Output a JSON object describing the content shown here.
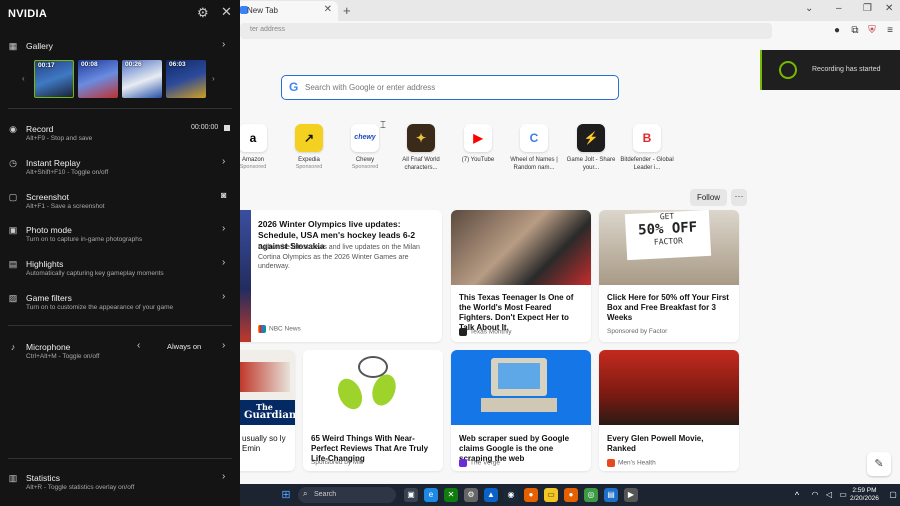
{
  "browser": {
    "tab_title": "New Tab",
    "address_placeholder": "ter address",
    "search_placeholder": "Search with Google or enter address",
    "window_controls": [
      "–",
      "❐",
      "✕"
    ]
  },
  "shortcuts": [
    {
      "label": "Amazon",
      "sub": "Sponsored",
      "glyph": "a",
      "color": "#000000"
    },
    {
      "label": "Expedia",
      "sub": "Sponsored",
      "glyph": "↗",
      "color": "#f4d020"
    },
    {
      "label": "Chewy",
      "sub": "Sponsored",
      "glyph": "chewy",
      "color": "#1c49c2"
    },
    {
      "label": "All Fnaf World characters...",
      "sub": "",
      "glyph": "✦",
      "color": "#5a3b1e"
    },
    {
      "label": "(7) YouTube",
      "sub": "",
      "glyph": "▶",
      "color": "#ff0000"
    },
    {
      "label": "Wheel of Names | Random nam...",
      "sub": "",
      "glyph": "C",
      "color": "#3e7be8"
    },
    {
      "label": "Game Jolt - Share your...",
      "sub": "",
      "glyph": "⚡",
      "color": "#2f7f6f"
    },
    {
      "label": "Bitdefender - Global Leader i...",
      "sub": "",
      "glyph": "B",
      "color": "#e3262c"
    }
  ],
  "feed": {
    "follow_label": "Follow",
    "more_label": "···",
    "cards": [
      {
        "title": "2026 Winter Olympics live updates: Schedule, USA men's hockey leads 6-2 against Slovakia",
        "desc": "Follow the latest news and live updates on the Milan Cortina Olympics as the 2026 Winter Games are underway.",
        "source": "NBC News"
      },
      {
        "title": "This Texas Teenager Is One of the World's Most Feared Fighters. Don't Expect Her to Talk About It.",
        "source": "Texas Monthly"
      },
      {
        "title": "Click Here for 50% off Your First Box and Free Breakfast for 3 Weeks",
        "source": "Sponsored by Factor",
        "ad_text_1": "GET",
        "ad_text_2": "50% OFF",
        "ad_text_3": "FACTOR"
      },
      {
        "title": "usually so ly Emin",
        "source": "",
        "ad_text_1": "The",
        "ad_text_2": "Guardian"
      },
      {
        "title": "65 Weird Things With Near-Perfect Reviews That Are Truly Life-Changing",
        "source": "Sponsored by Mic"
      },
      {
        "title": "Web scraper sued by Google claims Google is the one scraping the web",
        "source": "The Verge"
      },
      {
        "title": "Every Glen Powell Movie, Ranked",
        "source": "Men's Health"
      }
    ]
  },
  "toast": {
    "message": "Recording has started"
  },
  "taskbar": {
    "search_placeholder": "Search",
    "time": "2:59 PM",
    "date": "2/20/2026"
  },
  "nvidia": {
    "brand": "NVIDIA",
    "gallery": {
      "title": "Gallery",
      "thumbs": [
        {
          "duration": "00:17"
        },
        {
          "duration": "00:08"
        },
        {
          "duration": "00:26"
        },
        {
          "duration": "06:03"
        }
      ]
    },
    "record": {
      "title": "Record",
      "sub": "Alt+F9 - Stop and save",
      "timer": "00:00:00"
    },
    "instant_replay": {
      "title": "Instant Replay",
      "sub": "Alt+Shift+F10 - Toggle on/off"
    },
    "screenshot": {
      "title": "Screenshot",
      "sub": "Alt+F1 - Save a screenshot"
    },
    "photo_mode": {
      "title": "Photo mode",
      "sub": "Turn on to capture in-game photographs"
    },
    "highlights": {
      "title": "Highlights",
      "sub": "Automatically capturing key gameplay moments"
    },
    "game_filters": {
      "title": "Game filters",
      "sub": "Turn on to customize the appearance of your game"
    },
    "microphone": {
      "title": "Microphone",
      "sub": "Ctrl+Alt+M - Toggle on/off",
      "value": "Always on"
    },
    "statistics": {
      "title": "Statistics",
      "sub": "Alt+R - Toggle statistics overlay on/off"
    },
    "accent_color": "#76b900"
  }
}
